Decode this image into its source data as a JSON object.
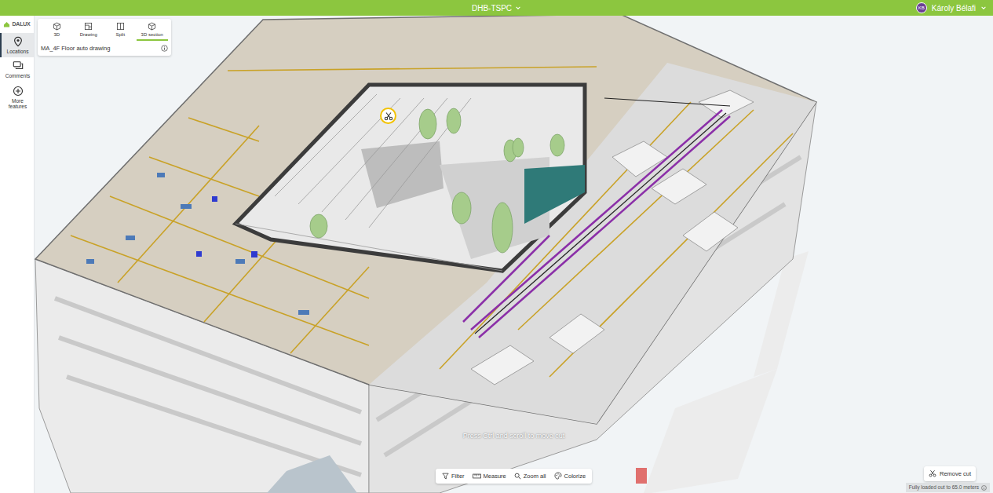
{
  "header": {
    "project": "DHB-TSPC",
    "user": {
      "initials": "KB",
      "name": "Károly Bélafi"
    }
  },
  "logo": "DALUX",
  "sidebar": {
    "items": [
      {
        "label": "Locations",
        "selected": true
      },
      {
        "label": "Comments",
        "selected": false
      },
      {
        "label": "More features",
        "selected": false
      }
    ]
  },
  "view_modes": {
    "tabs": [
      {
        "label": "3D",
        "selected": false
      },
      {
        "label": "Drawing",
        "selected": false
      },
      {
        "label": "Split",
        "selected": false
      },
      {
        "label": "3D section",
        "selected": true
      }
    ],
    "drawing_name": "MA_4F Floor auto drawing"
  },
  "hint": "Press Ctrl and scroll to move cut",
  "toolbar": [
    {
      "label": "Filter"
    },
    {
      "label": "Measure"
    },
    {
      "label": "Zoom all"
    },
    {
      "label": "Colorize"
    }
  ],
  "remove_cut": "Remove cut",
  "status": "Fully loaded out to 65.0 meters"
}
